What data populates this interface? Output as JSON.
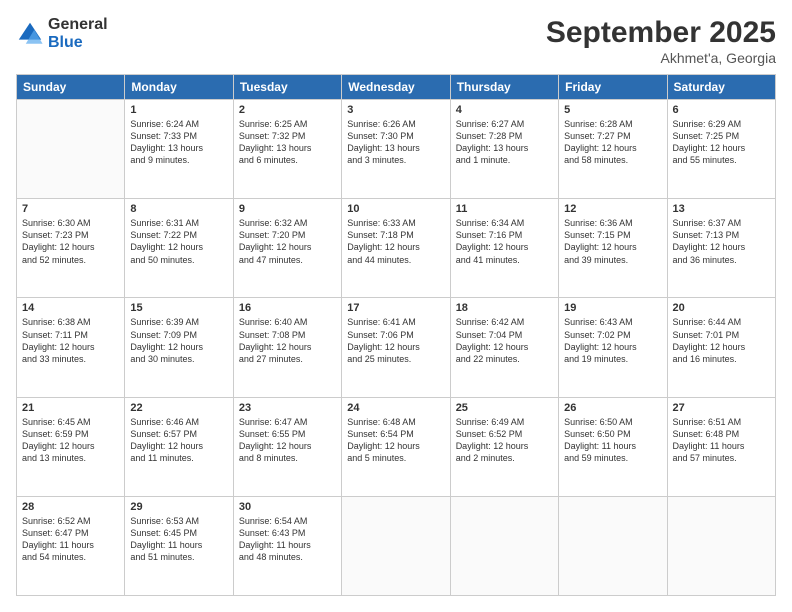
{
  "logo": {
    "general": "General",
    "blue": "Blue"
  },
  "title": "September 2025",
  "location": "Akhmet'a, Georgia",
  "days_of_week": [
    "Sunday",
    "Monday",
    "Tuesday",
    "Wednesday",
    "Thursday",
    "Friday",
    "Saturday"
  ],
  "weeks": [
    [
      {
        "day": "",
        "info": ""
      },
      {
        "day": "1",
        "info": "Sunrise: 6:24 AM\nSunset: 7:33 PM\nDaylight: 13 hours\nand 9 minutes."
      },
      {
        "day": "2",
        "info": "Sunrise: 6:25 AM\nSunset: 7:32 PM\nDaylight: 13 hours\nand 6 minutes."
      },
      {
        "day": "3",
        "info": "Sunrise: 6:26 AM\nSunset: 7:30 PM\nDaylight: 13 hours\nand 3 minutes."
      },
      {
        "day": "4",
        "info": "Sunrise: 6:27 AM\nSunset: 7:28 PM\nDaylight: 13 hours\nand 1 minute."
      },
      {
        "day": "5",
        "info": "Sunrise: 6:28 AM\nSunset: 7:27 PM\nDaylight: 12 hours\nand 58 minutes."
      },
      {
        "day": "6",
        "info": "Sunrise: 6:29 AM\nSunset: 7:25 PM\nDaylight: 12 hours\nand 55 minutes."
      }
    ],
    [
      {
        "day": "7",
        "info": "Sunrise: 6:30 AM\nSunset: 7:23 PM\nDaylight: 12 hours\nand 52 minutes."
      },
      {
        "day": "8",
        "info": "Sunrise: 6:31 AM\nSunset: 7:22 PM\nDaylight: 12 hours\nand 50 minutes."
      },
      {
        "day": "9",
        "info": "Sunrise: 6:32 AM\nSunset: 7:20 PM\nDaylight: 12 hours\nand 47 minutes."
      },
      {
        "day": "10",
        "info": "Sunrise: 6:33 AM\nSunset: 7:18 PM\nDaylight: 12 hours\nand 44 minutes."
      },
      {
        "day": "11",
        "info": "Sunrise: 6:34 AM\nSunset: 7:16 PM\nDaylight: 12 hours\nand 41 minutes."
      },
      {
        "day": "12",
        "info": "Sunrise: 6:36 AM\nSunset: 7:15 PM\nDaylight: 12 hours\nand 39 minutes."
      },
      {
        "day": "13",
        "info": "Sunrise: 6:37 AM\nSunset: 7:13 PM\nDaylight: 12 hours\nand 36 minutes."
      }
    ],
    [
      {
        "day": "14",
        "info": "Sunrise: 6:38 AM\nSunset: 7:11 PM\nDaylight: 12 hours\nand 33 minutes."
      },
      {
        "day": "15",
        "info": "Sunrise: 6:39 AM\nSunset: 7:09 PM\nDaylight: 12 hours\nand 30 minutes."
      },
      {
        "day": "16",
        "info": "Sunrise: 6:40 AM\nSunset: 7:08 PM\nDaylight: 12 hours\nand 27 minutes."
      },
      {
        "day": "17",
        "info": "Sunrise: 6:41 AM\nSunset: 7:06 PM\nDaylight: 12 hours\nand 25 minutes."
      },
      {
        "day": "18",
        "info": "Sunrise: 6:42 AM\nSunset: 7:04 PM\nDaylight: 12 hours\nand 22 minutes."
      },
      {
        "day": "19",
        "info": "Sunrise: 6:43 AM\nSunset: 7:02 PM\nDaylight: 12 hours\nand 19 minutes."
      },
      {
        "day": "20",
        "info": "Sunrise: 6:44 AM\nSunset: 7:01 PM\nDaylight: 12 hours\nand 16 minutes."
      }
    ],
    [
      {
        "day": "21",
        "info": "Sunrise: 6:45 AM\nSunset: 6:59 PM\nDaylight: 12 hours\nand 13 minutes."
      },
      {
        "day": "22",
        "info": "Sunrise: 6:46 AM\nSunset: 6:57 PM\nDaylight: 12 hours\nand 11 minutes."
      },
      {
        "day": "23",
        "info": "Sunrise: 6:47 AM\nSunset: 6:55 PM\nDaylight: 12 hours\nand 8 minutes."
      },
      {
        "day": "24",
        "info": "Sunrise: 6:48 AM\nSunset: 6:54 PM\nDaylight: 12 hours\nand 5 minutes."
      },
      {
        "day": "25",
        "info": "Sunrise: 6:49 AM\nSunset: 6:52 PM\nDaylight: 12 hours\nand 2 minutes."
      },
      {
        "day": "26",
        "info": "Sunrise: 6:50 AM\nSunset: 6:50 PM\nDaylight: 11 hours\nand 59 minutes."
      },
      {
        "day": "27",
        "info": "Sunrise: 6:51 AM\nSunset: 6:48 PM\nDaylight: 11 hours\nand 57 minutes."
      }
    ],
    [
      {
        "day": "28",
        "info": "Sunrise: 6:52 AM\nSunset: 6:47 PM\nDaylight: 11 hours\nand 54 minutes."
      },
      {
        "day": "29",
        "info": "Sunrise: 6:53 AM\nSunset: 6:45 PM\nDaylight: 11 hours\nand 51 minutes."
      },
      {
        "day": "30",
        "info": "Sunrise: 6:54 AM\nSunset: 6:43 PM\nDaylight: 11 hours\nand 48 minutes."
      },
      {
        "day": "",
        "info": ""
      },
      {
        "day": "",
        "info": ""
      },
      {
        "day": "",
        "info": ""
      },
      {
        "day": "",
        "info": ""
      }
    ]
  ]
}
